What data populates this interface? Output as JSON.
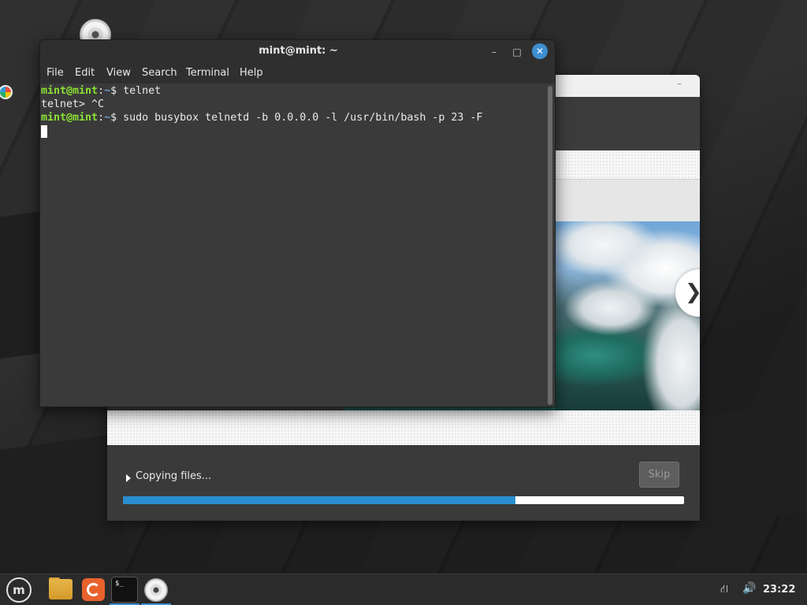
{
  "terminal": {
    "title": "mint@mint: ~",
    "menu": [
      "File",
      "Edit",
      "View",
      "Search",
      "Terminal",
      "Help"
    ],
    "lines": [
      {
        "user": "mint@mint",
        "sep": ":",
        "path": "~",
        "rest": "$ telnet"
      },
      {
        "text": "telnet> ^C"
      },
      {
        "user": "mint@mint",
        "sep": ":",
        "path": "~",
        "rest": "$ sudo busybox telnetd -b 0.0.0.0 -l /usr/bin/bash -p 23 -F"
      }
    ],
    "minimize_glyph": "–",
    "maximize_glyph": "□",
    "close_glyph": "✕"
  },
  "installer": {
    "status_text": "Copying files...",
    "skip_label": "Skip",
    "progress": 0.7,
    "next_glyph": "❯",
    "minimize_glyph": "–"
  },
  "taskbar": {
    "menu_glyph": "m",
    "terminal_glyph": "$_",
    "clock": "23:22",
    "network_glyph": "⛙",
    "volume_glyph": "🔊",
    "accent_color": "#3d8fd1"
  }
}
